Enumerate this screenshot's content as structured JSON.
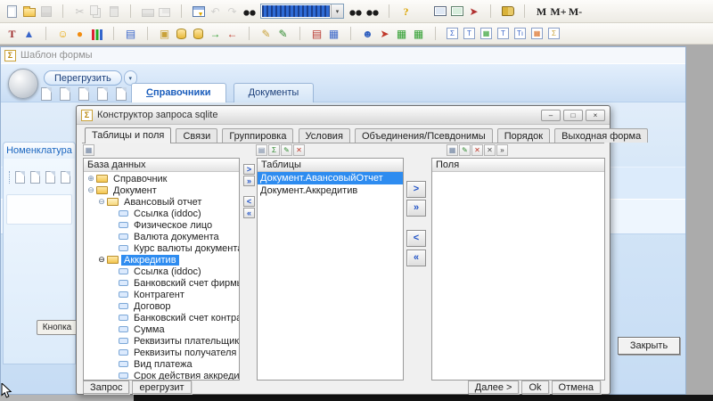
{
  "toolbar1": {
    "left": [
      {
        "name": "new-file-icon",
        "shape": "s-page",
        "inter": "true"
      },
      {
        "name": "open-folder-icon",
        "shape": "s-folder",
        "inter": "true"
      },
      {
        "name": "save-icon",
        "shape": "s-disk",
        "disabled": true,
        "inter": "true"
      },
      {
        "name": "separator",
        "shape": "tb-sep",
        "inter": "false"
      },
      {
        "name": "cut-icon",
        "glyph": "✂",
        "color": "#8f8d88",
        "disabled": true,
        "inter": "true"
      },
      {
        "name": "copy-icon",
        "shape": "s-copy",
        "disabled": true,
        "inter": "true"
      },
      {
        "name": "paste-icon",
        "shape": "s-paste",
        "disabled": true,
        "inter": "true"
      },
      {
        "name": "separator",
        "shape": "tb-sep",
        "inter": "false"
      },
      {
        "name": "print-icon",
        "shape": "s-printer",
        "disabled": true,
        "inter": "true"
      },
      {
        "name": "print-preview-icon",
        "shape": "s-preview",
        "disabled": true,
        "inter": "true"
      },
      {
        "name": "separator",
        "shape": "tb-sep",
        "inter": "false"
      },
      {
        "name": "filter-window-icon",
        "shape": "s-filterwin",
        "inter": "true"
      },
      {
        "name": "undo-icon",
        "glyph": "↶",
        "color": "#a9a7a2",
        "disabled": true,
        "inter": "true"
      },
      {
        "name": "redo-icon",
        "glyph": "↷",
        "color": "#a9a7a2",
        "disabled": true,
        "inter": "true"
      },
      {
        "name": "find-icon",
        "shape": "s-binoc",
        "inter": "true"
      }
    ],
    "combo": {
      "value": "",
      "caret": "▾"
    },
    "right": [
      {
        "name": "find-next-icon",
        "shape": "s-binoc",
        "inter": "true"
      },
      {
        "name": "find-prev-icon",
        "shape": "s-binoc",
        "inter": "true"
      },
      {
        "name": "separator",
        "shape": "tb-sep",
        "inter": "false"
      },
      {
        "name": "help-icon",
        "glyph": "?",
        "color": "#dba400",
        "bold": true,
        "inter": "true"
      },
      {
        "name": "spacer",
        "shape": "tb-space",
        "inter": "false"
      },
      {
        "name": "screen-icon",
        "shape": "s-screen",
        "inter": "true"
      },
      {
        "name": "screen-report-icon",
        "shape": "s-screen2",
        "inter": "true"
      },
      {
        "name": "pointer-sparkle-icon",
        "glyph": "➤",
        "color": "#b03030",
        "inter": "true"
      },
      {
        "name": "separator",
        "shape": "tb-sep",
        "inter": "false"
      },
      {
        "name": "book-icon",
        "shape": "s-book",
        "inter": "true"
      },
      {
        "name": "separator",
        "shape": "tb-sep",
        "inter": "false"
      },
      {
        "name": "memory-m-button",
        "glyph": "M",
        "color": "#222222",
        "bold": true,
        "inter": "true"
      },
      {
        "name": "memory-m-plus-button",
        "glyph": "M+",
        "color": "#222222",
        "bold": true,
        "inter": "true"
      },
      {
        "name": "memory-m-minus-button",
        "glyph": "M-",
        "color": "#222222",
        "bold": true,
        "inter": "true"
      }
    ]
  },
  "toolbar2": {
    "items": [
      {
        "name": "report-filter-icon",
        "glyph": "T",
        "color": "#9c2a2a",
        "bold": true,
        "inter": "true"
      },
      {
        "name": "org-chart-icon",
        "glyph": "▲",
        "color": "#3a66c9",
        "inter": "true"
      },
      {
        "name": "separator",
        "shape": "tb-sep",
        "inter": "false"
      },
      {
        "name": "smiley-icon",
        "glyph": "☺",
        "color": "#e8a500",
        "inter": "true"
      },
      {
        "name": "orange-icon",
        "glyph": "●",
        "color": "#f28c0f",
        "inter": "true"
      },
      {
        "name": "bar-chart-icon",
        "shape": "s-bars",
        "inter": "true"
      },
      {
        "name": "separator",
        "shape": "tb-sep",
        "inter": "false"
      },
      {
        "name": "books-icon",
        "glyph": "▤",
        "color": "#3a66c9",
        "inter": "true"
      },
      {
        "name": "separator",
        "shape": "tb-sep",
        "inter": "false"
      },
      {
        "name": "open-box-icon",
        "glyph": "▣",
        "color": "#c9a23a",
        "inter": "true"
      },
      {
        "name": "database-doc-icon",
        "shape": "s-cyl",
        "inter": "true"
      },
      {
        "name": "database-export-icon",
        "shape": "s-cyl",
        "inter": "true"
      },
      {
        "name": "login-icon",
        "glyph": "→",
        "color": "#2f9e2f",
        "bold": true,
        "inter": "true"
      },
      {
        "name": "logout-icon",
        "glyph": "←",
        "color": "#c0392b",
        "bold": true,
        "inter": "true"
      },
      {
        "name": "separator",
        "shape": "tb-sep",
        "inter": "false"
      },
      {
        "name": "note-edit-icon",
        "glyph": "✎",
        "color": "#c9a23a",
        "inter": "true"
      },
      {
        "name": "pencil-icon",
        "glyph": "✎",
        "color": "#2f8a2f",
        "inter": "true"
      },
      {
        "name": "separator",
        "shape": "tb-sep",
        "inter": "false"
      },
      {
        "name": "books-stack-icon",
        "glyph": "▤",
        "color": "#b8372f",
        "inter": "true"
      },
      {
        "name": "book-table-icon",
        "glyph": "▦",
        "color": "#3a66c9",
        "inter": "true"
      },
      {
        "name": "separator",
        "shape": "tb-sep",
        "inter": "false"
      },
      {
        "name": "cool-face-icon",
        "glyph": "☻",
        "color": "#2f5fbf",
        "inter": "true"
      },
      {
        "name": "export-doc-icon",
        "glyph": "➤",
        "color": "#c0392b",
        "inter": "true"
      },
      {
        "name": "table-calendar-icon",
        "glyph": "▦",
        "color": "#2f9e2f",
        "inter": "true"
      },
      {
        "name": "table-calendar2-icon",
        "glyph": "▦",
        "color": "#2f9e2f",
        "inter": "true"
      },
      {
        "name": "separator",
        "shape": "tb-sep",
        "inter": "false"
      },
      {
        "name": "sum-doc-icon",
        "glyph": "Σ",
        "color": "#3a66c9",
        "boxed": true,
        "inter": "true"
      },
      {
        "name": "table-t1-icon",
        "glyph": "T",
        "color": "#3a66c9",
        "boxed": true,
        "inter": "true"
      },
      {
        "name": "table-grid-icon",
        "glyph": "▦",
        "color": "#2f9e2f",
        "boxed": true,
        "inter": "true"
      },
      {
        "name": "table-t2-icon",
        "glyph": "T",
        "color": "#3a66c9",
        "boxed": true,
        "inter": "true"
      },
      {
        "name": "table-ti-icon",
        "glyph": "Tı",
        "color": "#3a66c9",
        "boxed": true,
        "inter": "true"
      },
      {
        "name": "table-orange-icon",
        "glyph": "▦",
        "color": "#d96a1f",
        "boxed": true,
        "inter": "true"
      },
      {
        "name": "sigma-doc-icon",
        "glyph": "Σ",
        "color": "#c9a23a",
        "boxed": true,
        "inter": "true"
      }
    ]
  },
  "main_window": {
    "title": "Шаблон формы",
    "title_icon_glyph": "Σ",
    "reload_button": {
      "label": "Перегрузить",
      "caret": "▾"
    },
    "pages": [
      "page-icon",
      "page-icon",
      "page-icon",
      "page-icon",
      "page-icon",
      "page-icon",
      "page-icon"
    ],
    "tabs": [
      {
        "label": "Справочники",
        "active": true
      },
      {
        "label": "Документы",
        "active": false
      }
    ],
    "left_panel": {
      "header": "Номенклатура",
      "pages": [
        "page-icon",
        "page-icon",
        "page-icon",
        "page-icon"
      ]
    },
    "knopka_button": "Кнопка",
    "close_button": "Закрыть"
  },
  "dialog": {
    "title": "Конструктор запроса sqlite",
    "title_icon_glyph": "Σ",
    "window_buttons": [
      {
        "name": "minimize-button",
        "glyph": "–"
      },
      {
        "name": "maximize-button",
        "glyph": "□"
      },
      {
        "name": "close-button",
        "glyph": "×"
      }
    ],
    "tabs": [
      {
        "label": "Таблицы и поля",
        "active": true
      },
      {
        "label": "Связи",
        "active": false
      },
      {
        "label": "Группировка",
        "active": false
      },
      {
        "label": "Условия",
        "active": false
      },
      {
        "label": "Объединения/Псевдонимы",
        "active": false
      },
      {
        "label": "Порядок",
        "active": false
      },
      {
        "label": "Выходная форма",
        "active": false
      }
    ],
    "tree_toolbar": [
      {
        "name": "table-view-icon",
        "glyph": "▦",
        "color": "#6b7f9e"
      }
    ],
    "tables_toolbar": [
      {
        "name": "rename-table-icon",
        "glyph": "▤",
        "color": "#6b7f9e"
      },
      {
        "name": "sum-table-icon",
        "glyph": "Σ",
        "color": "#2f8a2f"
      },
      {
        "name": "edit-table-icon",
        "glyph": "✎",
        "color": "#2f8a2f"
      },
      {
        "name": "delete-table-icon",
        "glyph": "✕",
        "color": "#c0392b"
      }
    ],
    "fields_toolbar": [
      {
        "name": "add-field-icon",
        "glyph": "▦",
        "color": "#6b7f9e"
      },
      {
        "name": "edit-field-icon",
        "glyph": "✎",
        "color": "#2f8a2f"
      },
      {
        "name": "delete-field-icon",
        "glyph": "✕",
        "color": "#c0392b"
      },
      {
        "name": "clear-fields-icon",
        "glyph": "✕",
        "color": "#555555"
      },
      {
        "name": "reorder-fields-icon",
        "glyph": "»",
        "color": "#333333"
      }
    ],
    "tree": {
      "header": "База данных",
      "scroll_up": "▲",
      "scroll_down": "▼",
      "items": [
        {
          "label": "Справочник",
          "level": 0,
          "toggle": "⊕",
          "icon": "folder",
          "selected": false
        },
        {
          "label": "Документ",
          "level": 0,
          "toggle": "⊖",
          "icon": "folder",
          "selected": false
        },
        {
          "label": "Авансовый отчет",
          "level": 1,
          "toggle": "⊖",
          "icon": "folder-open",
          "selected": false
        },
        {
          "label": "Ссылка (iddoc)",
          "level": 2,
          "toggle": "",
          "icon": "field",
          "selected": false
        },
        {
          "label": "Физическое лицо",
          "level": 2,
          "toggle": "",
          "icon": "field",
          "selected": false
        },
        {
          "label": "Валюта документа",
          "level": 2,
          "toggle": "",
          "icon": "field",
          "selected": false
        },
        {
          "label": "Курс валюты документа",
          "level": 2,
          "toggle": "",
          "icon": "field",
          "selected": false
        },
        {
          "label": "Аккредитив",
          "level": 1,
          "toggle": "⊖",
          "icon": "folder",
          "selected": true
        },
        {
          "label": "Ссылка (iddoc)",
          "level": 2,
          "toggle": "",
          "icon": "field",
          "selected": false
        },
        {
          "label": "Банковский счет фирмы",
          "level": 2,
          "toggle": "",
          "icon": "field",
          "selected": false
        },
        {
          "label": "Контрагент",
          "level": 2,
          "toggle": "",
          "icon": "field",
          "selected": false
        },
        {
          "label": "Договор",
          "level": 2,
          "toggle": "",
          "icon": "field",
          "selected": false
        },
        {
          "label": "Банковский счет контрагента",
          "level": 2,
          "toggle": "",
          "icon": "field",
          "selected": false
        },
        {
          "label": "Сумма",
          "level": 2,
          "toggle": "",
          "icon": "field",
          "selected": false
        },
        {
          "label": "Реквизиты плательщика",
          "level": 2,
          "toggle": "",
          "icon": "field",
          "selected": false
        },
        {
          "label": "Реквизиты получателя",
          "level": 2,
          "toggle": "",
          "icon": "field",
          "selected": false
        },
        {
          "label": "Вид платежа",
          "level": 2,
          "toggle": "",
          "icon": "field",
          "selected": false
        },
        {
          "label": "Срок действия аккредитива",
          "level": 2,
          "toggle": "",
          "icon": "field",
          "selected": false
        }
      ]
    },
    "tables": {
      "header": "Таблицы",
      "items": [
        {
          "label": "Документ.АвансовыйОтчет",
          "selected": true
        },
        {
          "label": "Документ.Аккредитив",
          "selected": false
        }
      ]
    },
    "fields": {
      "header": "Поля",
      "items": []
    },
    "transfer_small": [
      {
        "name": "move-right-small-button",
        "glyph": ">"
      },
      {
        "name": "move-all-right-small-button",
        "glyph": "»"
      },
      {
        "name": "move-left-small-button",
        "glyph": "<"
      },
      {
        "name": "move-all-left-small-button",
        "glyph": "«"
      }
    ],
    "transfer_large": [
      {
        "name": "move-right-button",
        "glyph": ">"
      },
      {
        "name": "move-all-right-button",
        "glyph": "»"
      },
      {
        "name": "move-left-button",
        "glyph": "<"
      },
      {
        "name": "move-all-left-button",
        "glyph": "«"
      }
    ],
    "footer": {
      "left": [
        {
          "label": "Запрос",
          "name": "query-button"
        },
        {
          "label": "ерегрузит",
          "name": "reload-query-button"
        }
      ],
      "right": [
        {
          "label": "Далее >",
          "name": "next-button"
        },
        {
          "label": "Ok",
          "name": "ok-button"
        },
        {
          "label": "Отмена",
          "name": "cancel-button"
        }
      ]
    }
  },
  "colors": {
    "selection": "#2e8cf0",
    "accent_blue": "#1a5dbc",
    "desktop": "#ababab"
  }
}
